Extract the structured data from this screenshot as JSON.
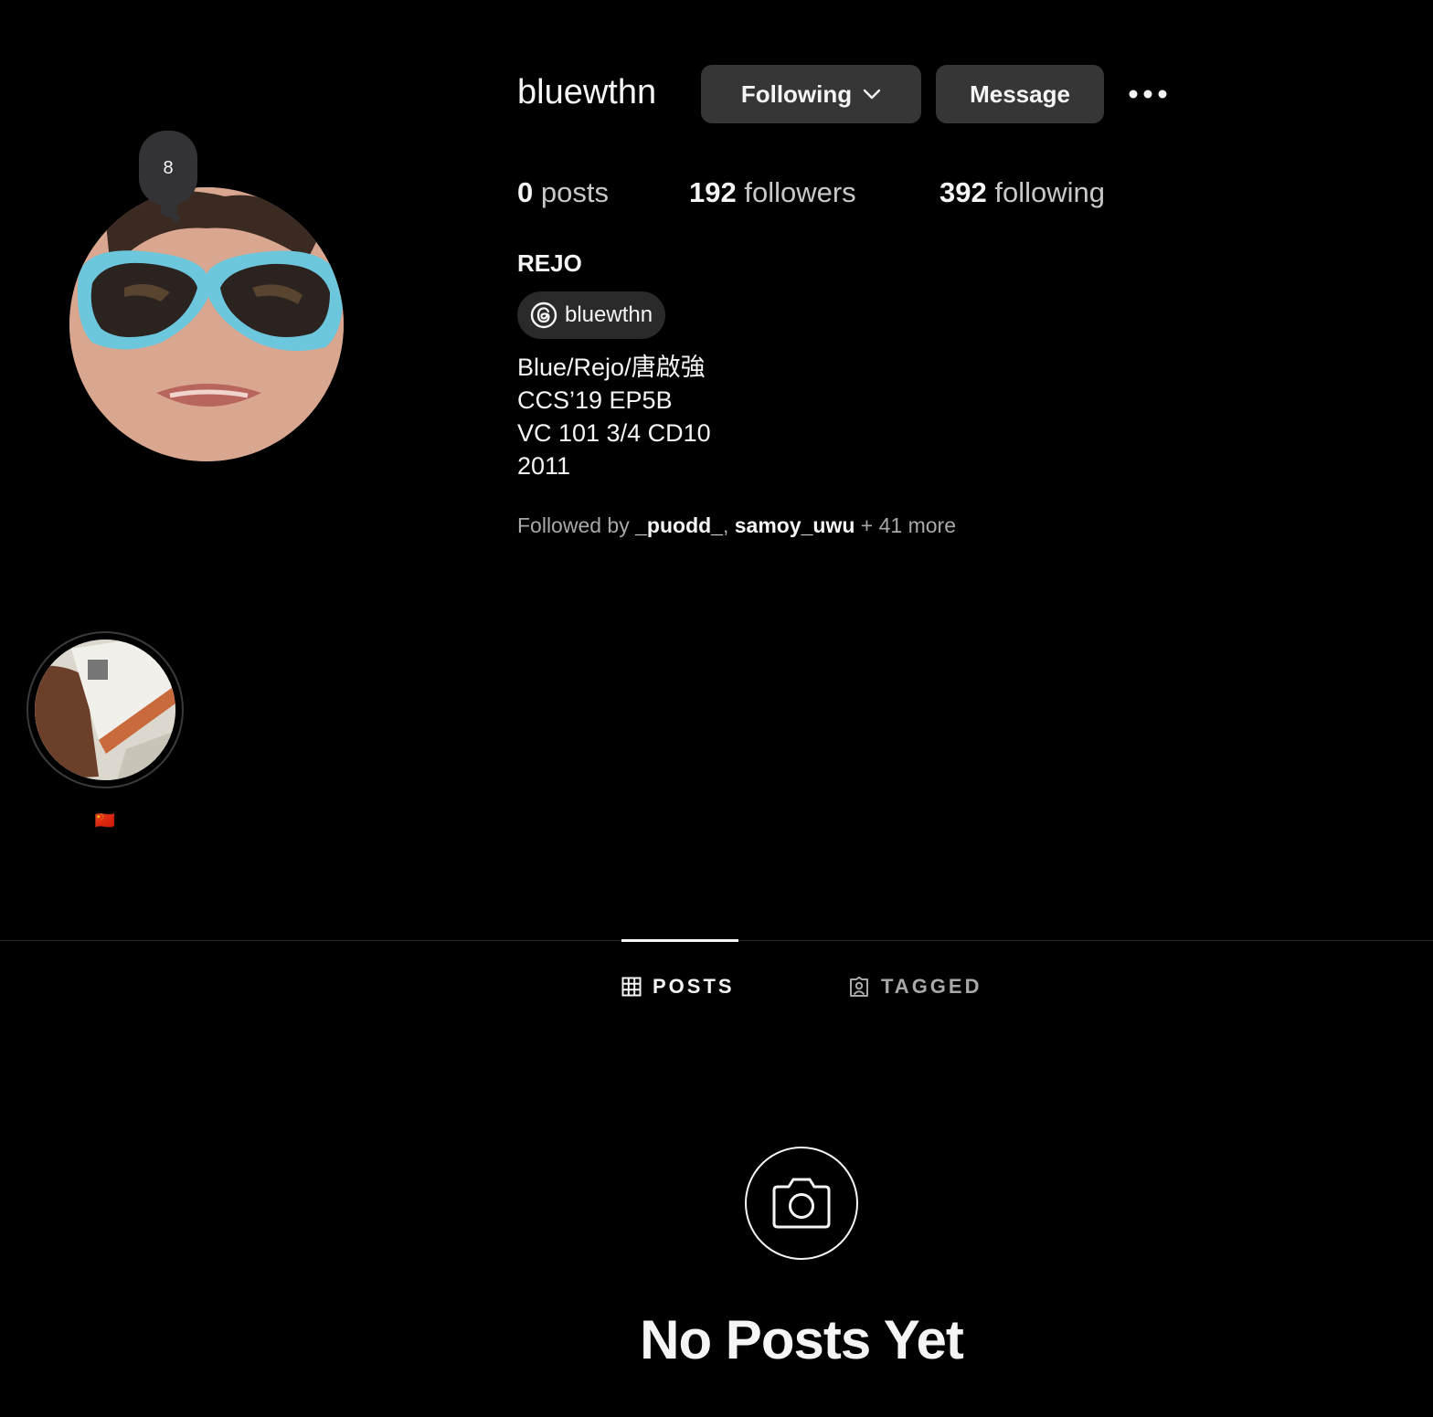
{
  "profile": {
    "username": "bluewthn",
    "note_text": "8",
    "full_name": "REJO",
    "threads_handle": "bluewthn",
    "bio_lines": [
      "Blue/Rejo/唐啟強",
      "CCS’19 EP5B",
      "VC 101 3/4 CD10",
      "2011"
    ]
  },
  "actions": {
    "following_label": "Following",
    "message_label": "Message"
  },
  "stats": {
    "posts_count": "0",
    "posts_label": "posts",
    "followers_count": "192",
    "followers_label": "followers",
    "following_count": "392",
    "following_label": "following"
  },
  "followed_by": {
    "prefix": "Followed by",
    "user1": "_puodd_",
    "sep": ",",
    "user2": "samoy_uwu",
    "more": "+ 41 more"
  },
  "highlights": [
    {
      "label": "🇨🇳"
    }
  ],
  "tabs": {
    "posts_label": "POSTS",
    "tagged_label": "TAGGED"
  },
  "empty_state": {
    "title": "No Posts Yet"
  },
  "colors": {
    "background": "#000000",
    "button_bg": "#363636",
    "muted_text": "#a8a8a8"
  }
}
